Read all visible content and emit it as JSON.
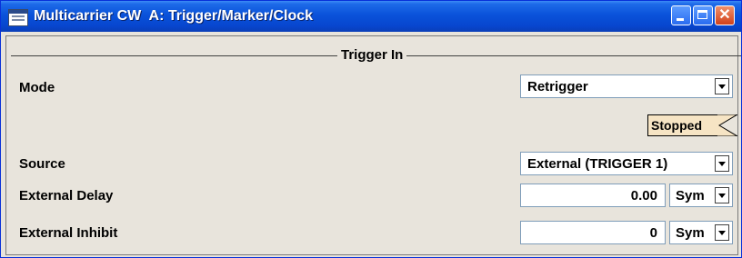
{
  "window": {
    "title": "Multicarrier CW  A: Trigger/Marker/Clock",
    "controls": {
      "minimize_icon": "minimize-icon",
      "maximize_icon": "maximize-icon",
      "close_icon": "close-icon"
    }
  },
  "group": {
    "title": "Trigger In"
  },
  "fields": {
    "mode": {
      "label": "Mode",
      "value": "Retrigger"
    },
    "status": {
      "value": "Stopped"
    },
    "source": {
      "label": "Source",
      "value": "External (TRIGGER 1)"
    },
    "external_delay": {
      "label": "External Delay",
      "value": "0.00",
      "unit": "Sym"
    },
    "external_inhibit": {
      "label": "External Inhibit",
      "value": "0",
      "unit": "Sym"
    }
  },
  "colors": {
    "titlebar": "#0a52da",
    "panel": "#e8e4dc",
    "status_badge": "#f6e4c4",
    "close_button": "#d2411a"
  }
}
